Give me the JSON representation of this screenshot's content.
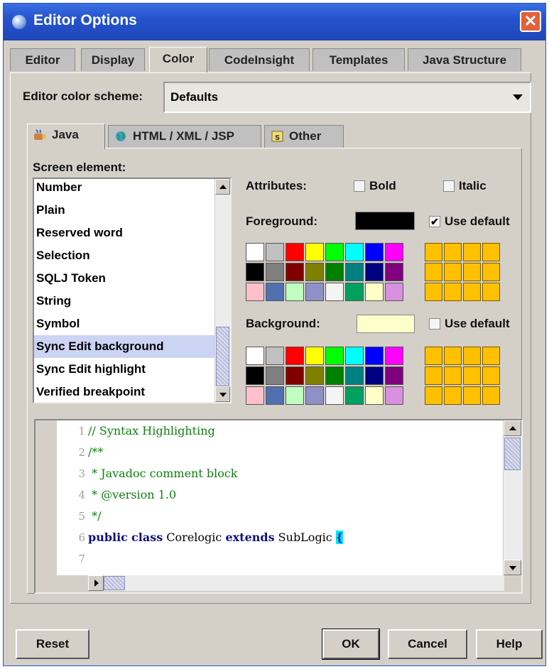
{
  "window": {
    "title": "Editor Options",
    "close_label": "✕"
  },
  "tabs": [
    "Editor",
    "Display",
    "Color",
    "CodeInsight",
    "Templates",
    "Java Structure"
  ],
  "active_tab": "Color",
  "scheme": {
    "label": "Editor color scheme:",
    "value": "Defaults"
  },
  "subtabs": [
    {
      "label": "Java",
      "icon": "java-icon"
    },
    {
      "label": "HTML / XML / JSP",
      "icon": "globe-icon"
    },
    {
      "label": "Other",
      "icon": "other-icon"
    }
  ],
  "screen_element": {
    "label": "Screen element:",
    "items": [
      "Number",
      "Plain",
      "Reserved word",
      "Selection",
      "SQLJ Token",
      "String",
      "Symbol",
      "Sync Edit background",
      "Sync Edit highlight",
      "Verified breakpoint"
    ],
    "selected": "Sync Edit background"
  },
  "attributes": {
    "label": "Attributes:",
    "bold": "Bold",
    "italic": "Italic",
    "bold_checked": false,
    "italic_checked": false
  },
  "foreground": {
    "label": "Foreground:",
    "color": "#000000",
    "use_default": "Use default",
    "use_default_checked": true
  },
  "background": {
    "label": "Background:",
    "color": "#ffffcc",
    "use_default": "Use default",
    "use_default_checked": false
  },
  "palette": [
    "#ffffff",
    "#c0c0c0",
    "#ff0000",
    "#ffff00",
    "#00ff00",
    "#00ffff",
    "#0000ff",
    "#ff00ff",
    "#000000",
    "#808080",
    "#800000",
    "#808000",
    "#008000",
    "#008080",
    "#000080",
    "#800080",
    "#ffc0cb",
    "#5070b0",
    "#c0ffc0",
    "#9090c8",
    "#f4f4f4",
    "#00a060",
    "#ffffc8",
    "#d890e0"
  ],
  "custom_color": "#ffc000",
  "code": {
    "line_numbers": [
      "1",
      "2",
      "3",
      "4",
      "5",
      "6",
      "7"
    ],
    "line1": "// Syntax Highlighting",
    "line2": "/**",
    "line3": " * Javadoc comment block",
    "line4": " * @version 1.0",
    "line5": " */",
    "line6": {
      "kw1": "public",
      "kw2": "class",
      "name": "Corelogic",
      "kw3": "extends",
      "parent": "SubLogic",
      "brace": "{"
    }
  },
  "buttons": {
    "reset": "Reset",
    "ok": "OK",
    "cancel": "Cancel",
    "help": "Help"
  }
}
